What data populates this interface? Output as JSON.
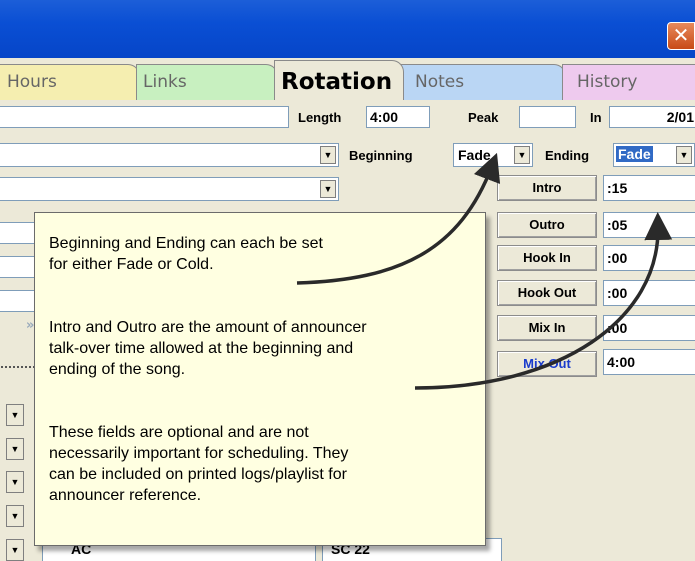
{
  "window": {
    "close_glyph": "✕"
  },
  "tabs": [
    {
      "label": "Hours"
    },
    {
      "label": "Links"
    },
    {
      "label": "Rotation"
    },
    {
      "label": "Notes"
    },
    {
      "label": "History"
    }
  ],
  "fields": {
    "length_label": "Length",
    "length_value": "4:00",
    "peak_label": "Peak",
    "peak_value": "",
    "in_label": "In",
    "in_value": "2/01",
    "beginning_label": "Beginning",
    "beginning_value": "Fade",
    "ending_label": "Ending",
    "ending_value": "Fade"
  },
  "timing": [
    {
      "label": "Intro",
      "value": ":15"
    },
    {
      "label": "Outro",
      "value": ":05"
    },
    {
      "label": "Hook In",
      "value": ":00"
    },
    {
      "label": "Hook Out",
      "value": ":00"
    },
    {
      "label": "Mix In",
      "value": ":00"
    },
    {
      "label": "Mix Out",
      "value": "4:00"
    }
  ],
  "bottom_row": {
    "left_text": "AC",
    "right_text": "SC 22"
  },
  "callout": {
    "p1": "Beginning and Ending can each be set for either Fade or Cold.",
    "p2": "Intro and Outro are the amount of announcer talk-over time allowed at the beginning and ending of the song.",
    "p3": "These fields are optional and are not necessarily important for scheduling. They can be included on printed logs/playlist for announcer reference."
  },
  "colors": {
    "titlebar": "#0a4fd4",
    "callout_bg": "#ffffe1",
    "mix_out": "#1a3ccc",
    "ending_highlight": "#316ac5"
  },
  "icons": {
    "dropdown": "▼",
    "nav": "»"
  }
}
